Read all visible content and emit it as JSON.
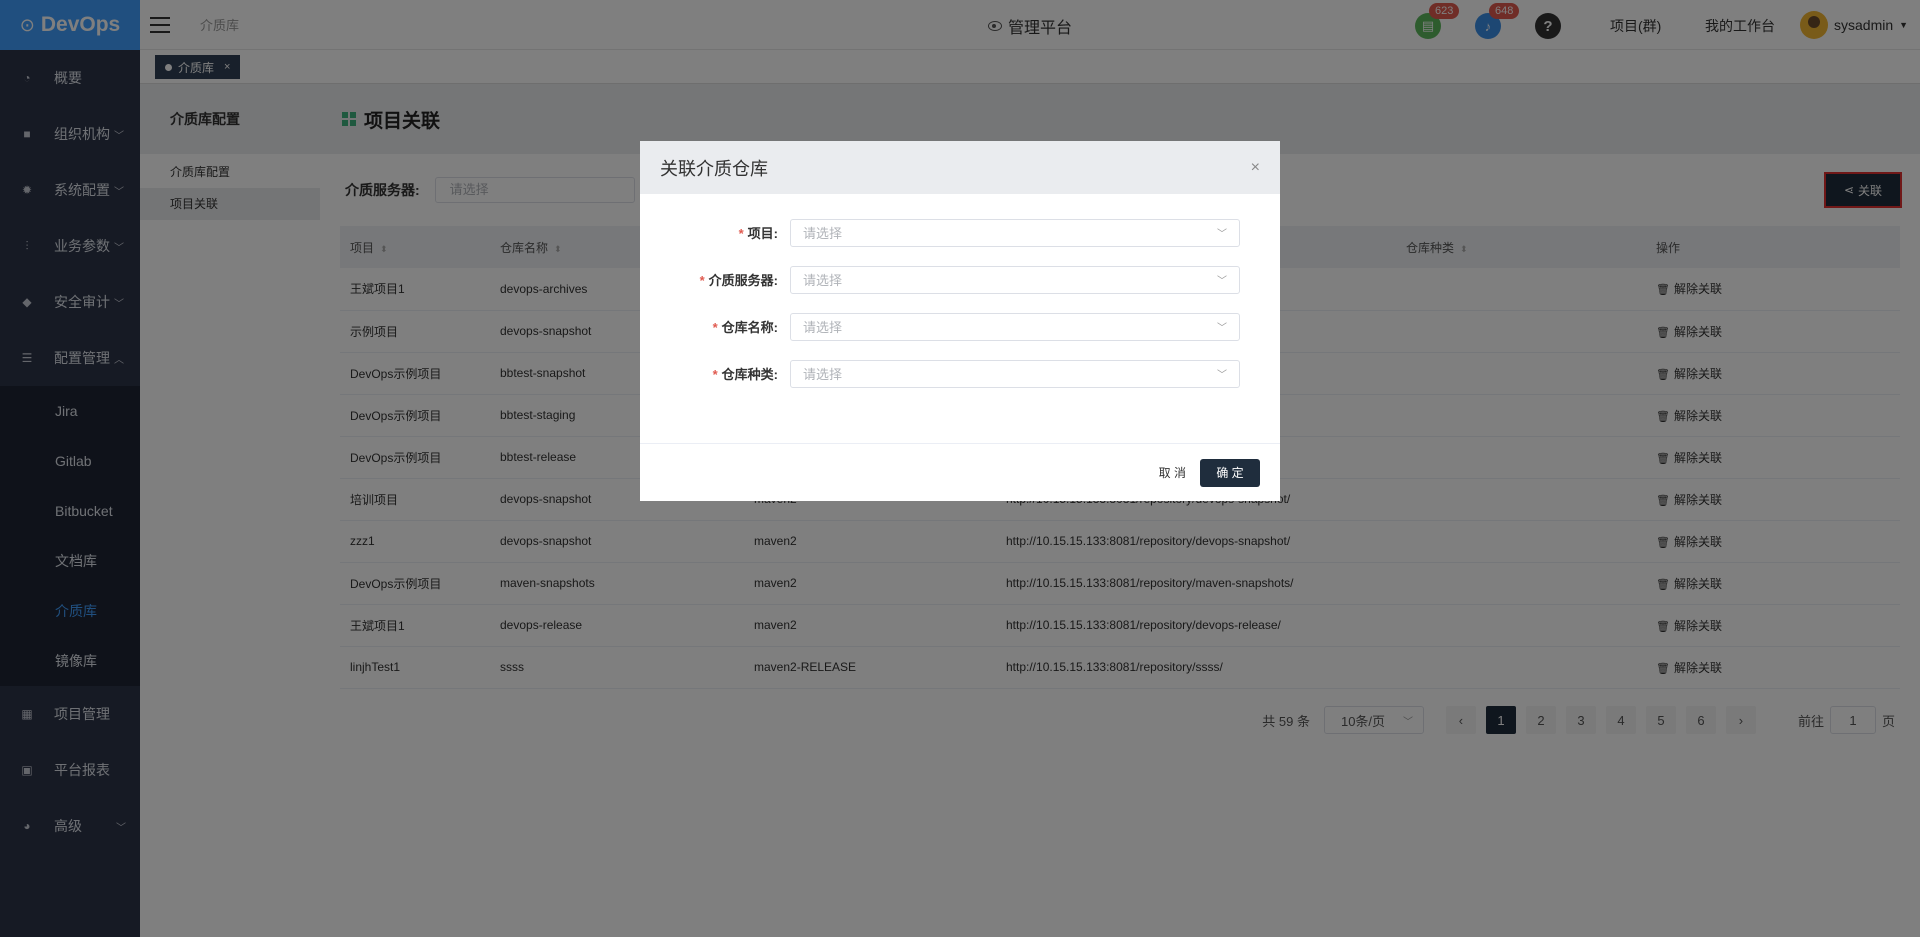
{
  "app": {
    "name": "DevOps"
  },
  "header": {
    "breadcrumb": "介质库",
    "platform": "管理平台",
    "badges": {
      "tasks": "623",
      "notifications": "648"
    },
    "links": [
      "项目(群)",
      "我的工作台"
    ],
    "user": "sysadmin"
  },
  "sidebar": {
    "items": [
      {
        "label": "概要",
        "icon": "dashboard-icon"
      },
      {
        "label": "组织机构",
        "icon": "lock-icon"
      },
      {
        "label": "系统配置",
        "icon": "gear-icon"
      },
      {
        "label": "业务参数",
        "icon": "sliders-icon"
      },
      {
        "label": "安全审计",
        "icon": "shield-icon"
      },
      {
        "label": "配置管理",
        "icon": "database-icon"
      }
    ],
    "sub_items": [
      "Jira",
      "Gitlab",
      "Bitbucket",
      "文档库",
      "介质库",
      "镜像库"
    ],
    "bottom_items": [
      {
        "label": "项目管理",
        "icon": "grid-icon"
      },
      {
        "label": "平台报表",
        "icon": "monitor-icon"
      },
      {
        "label": "高级",
        "icon": "palette-icon"
      }
    ]
  },
  "tabs": {
    "active": "介质库",
    "close": "×"
  },
  "config_panel": {
    "title": "介质库配置",
    "items": [
      "介质库配置",
      "项目关联"
    ]
  },
  "main": {
    "title": "项目关联",
    "filter_label": "介质服务器:",
    "filter_placeholder": "请选择",
    "link_button": "关联",
    "columns": [
      "项目",
      "仓库名称",
      "",
      "",
      "仓库种类",
      "操作"
    ],
    "rows": [
      [
        "王斌项目1",
        "devops-archives",
        "",
        "s/",
        "",
        "解除关联"
      ],
      [
        "示例项目",
        "devops-snapshot",
        "",
        "ot/",
        "",
        "解除关联"
      ],
      [
        "DevOps示例项目",
        "bbtest-snapshot",
        "",
        "t/",
        "",
        "解除关联"
      ],
      [
        "DevOps示例项目",
        "bbtest-staging",
        "",
        "",
        "",
        "解除关联"
      ],
      [
        "DevOps示例项目",
        "bbtest-release",
        "",
        "",
        "",
        "解除关联"
      ],
      [
        "培训项目",
        "devops-snapshot",
        "maven2",
        "http://10.15.15.133:8081/repository/devops-snapshot/",
        "",
        "解除关联"
      ],
      [
        "zzz1",
        "devops-snapshot",
        "maven2",
        "http://10.15.15.133:8081/repository/devops-snapshot/",
        "",
        "解除关联"
      ],
      [
        "DevOps示例项目",
        "maven-snapshots",
        "maven2",
        "http://10.15.15.133:8081/repository/maven-snapshots/",
        "",
        "解除关联"
      ],
      [
        "王斌项目1",
        "devops-release",
        "maven2",
        "http://10.15.15.133:8081/repository/devops-release/",
        "",
        "解除关联"
      ],
      [
        "linjhTest1",
        "ssss",
        "maven2-RELEASE",
        "http://10.15.15.133:8081/repository/ssss/",
        "",
        "解除关联"
      ]
    ]
  },
  "pagination": {
    "total": "共 59 条",
    "page_size": "10条/页",
    "pages": [
      "1",
      "2",
      "3",
      "4",
      "5",
      "6"
    ],
    "current": "1",
    "goto_label": "前往",
    "goto_value": "1",
    "goto_suffix": "页"
  },
  "dialog": {
    "title": "关联介质仓库",
    "close": "×",
    "fields": [
      {
        "label": "项目:",
        "placeholder": "请选择"
      },
      {
        "label": "介质服务器:",
        "placeholder": "请选择"
      },
      {
        "label": "仓库名称:",
        "placeholder": "请选择"
      },
      {
        "label": "仓库种类:",
        "placeholder": "请选择"
      }
    ],
    "cancel": "取 消",
    "ok": "确 定"
  },
  "colors": {
    "accent": "#409eff",
    "dark": "#1f2d3d",
    "sidebar": "#2c3448",
    "badge": "#e05a4f"
  }
}
